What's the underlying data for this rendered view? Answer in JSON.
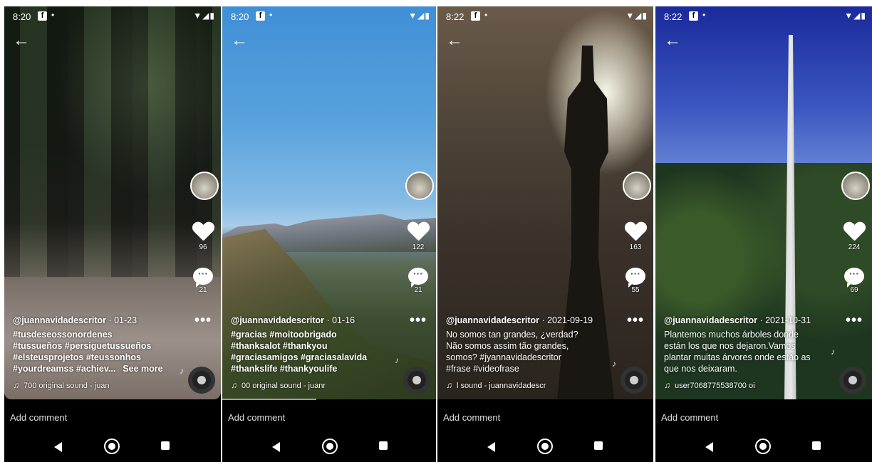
{
  "phones": [
    {
      "status_time": "8:20",
      "status_fb": "f",
      "author": "@juannavidadescritor",
      "date": " · 01-23",
      "lines": [
        "#tusdeseossonordenes",
        "#tussueños #persiguetussueños",
        "#elsteusprojetos #teussonhos",
        "#yourdreamss #achiev..."
      ],
      "see_more": "See more",
      "likes": "96",
      "comments": "21",
      "sound": "700   original sound - juan"
    },
    {
      "status_time": "8:20",
      "status_fb": "f",
      "author": "@juannavidadescritor",
      "date": " · 01-16",
      "lines": [
        "#gracias #moitoobrigado",
        "#thanksalot #thankyou",
        "#graciasamigos #graciasalavida",
        "#thankslife #thankyoulife"
      ],
      "likes": "122",
      "comments": "21",
      "sound": "00   original sound - juanr"
    },
    {
      "status_time": "8:22",
      "status_fb": "f",
      "author": "@juannavidadescritor",
      "date": " · 2021-09-19",
      "lines": [
        "No somos tan grandes, ¿verdad?",
        "Não somos assim tão grandes,",
        "somos?          #jyannavidadescritor",
        "#frase #videofrase"
      ],
      "likes": "163",
      "comments": "55",
      "sound": "l sound - juannavidadescr"
    },
    {
      "status_time": "8:22",
      "status_fb": "f",
      "author": "@juannavidadescritor",
      "date": " · 2021-10-31",
      "lines": [
        "Plantemos muchos árboles donde",
        "están los que nos dejaron.Vamos",
        "plantar muitas árvores onde estão as",
        "que nos deixaram."
      ],
      "likes": "224",
      "comments": "69",
      "sound": "user7068775538700   oi"
    }
  ],
  "comment_placeholder": "Add comment",
  "icons": {
    "back": "←",
    "more": "•••",
    "note": "♫",
    "dot": "•",
    "sys": "▼◢▮"
  }
}
